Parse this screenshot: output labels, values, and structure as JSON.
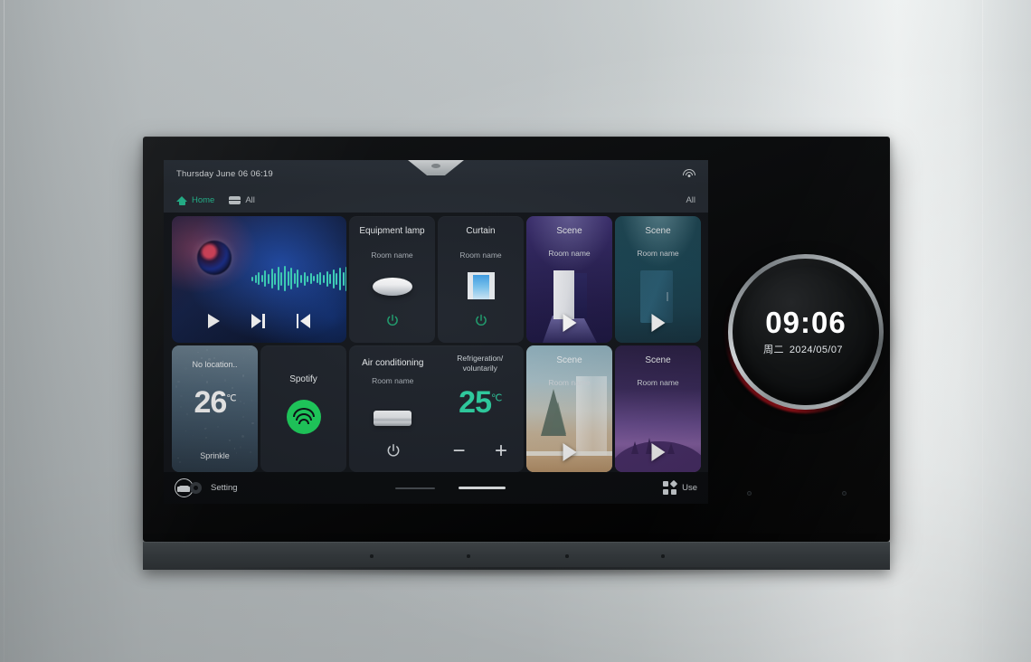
{
  "status_bar": {
    "datetime": "Thursday June 06  06:19",
    "wifi_icon": "wifi-icon"
  },
  "nav_bar": {
    "home_label": "Home",
    "home_icon": "home-icon",
    "all_label": "All",
    "all_icon": "rooms-icon",
    "right_label": "All"
  },
  "tiles": {
    "music": {
      "name": "music-player",
      "play_icon": "play-icon",
      "next_icon": "next-track-icon",
      "prev_icon": "previous-track-icon",
      "waveform_icon": "audio-waveform-icon",
      "album_icon": "album-art"
    },
    "lamp": {
      "title": "Equipment lamp",
      "subtitle": "Room name",
      "device_icon": "ceiling-lamp-icon",
      "power_icon": "power-icon",
      "power_color": "#1f9e6e"
    },
    "curtain": {
      "title": "Curtain",
      "subtitle": "Room name",
      "device_icon": "curtain-icon",
      "power_icon": "power-icon",
      "power_color": "#1f9e6e"
    },
    "scene1": {
      "title": "Scene",
      "subtitle": "Room name",
      "play_icon": "play-icon"
    },
    "scene2": {
      "title": "Scene",
      "subtitle": "Room name",
      "play_icon": "play-icon"
    },
    "scene3": {
      "title": "Scene",
      "subtitle": "Room name",
      "play_icon": "play-icon"
    },
    "scene4": {
      "title": "Scene",
      "subtitle": "Room name",
      "play_icon": "play-icon"
    },
    "weather": {
      "location": "No location..",
      "temperature": "26",
      "unit": "℃",
      "condition": "Sprinkle"
    },
    "spotify": {
      "title": "Spotify",
      "icon": "spotify-icon",
      "brand_color": "#1ed760"
    },
    "air_conditioning": {
      "title": "Air conditioning",
      "subtitle": "Room name",
      "device_icon": "air-conditioner-icon",
      "power_icon": "power-icon",
      "mode": "Refrigeration/ voluntarily",
      "temperature": "25",
      "unit": "℃",
      "temp_color": "#2fd6a6",
      "minus_label": "−",
      "plus_label": "+"
    }
  },
  "dock": {
    "assistant_icon": "assistant-icon",
    "gear_icon": "gear-icon",
    "setting_label": "Setting",
    "use_icon": "apps-grid-icon",
    "use_label": "Use"
  },
  "clock_module": {
    "time": "09:06",
    "weekday": "周二",
    "date": "2024/05/07"
  }
}
